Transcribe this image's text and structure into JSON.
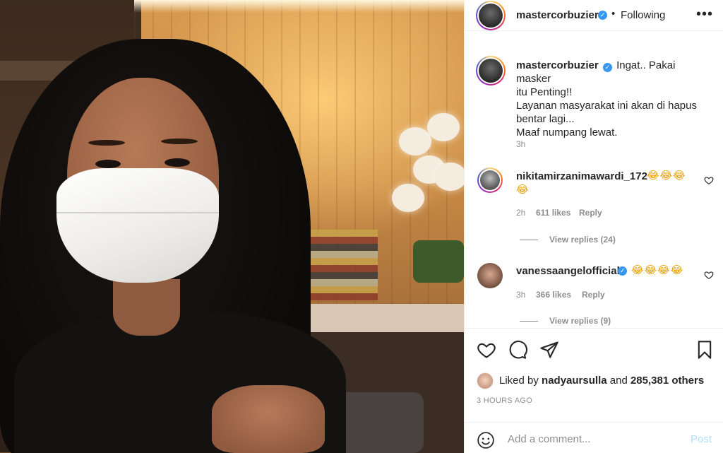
{
  "post": {
    "author": "mastercorbuzier",
    "following_separator": "•",
    "following_label": "Following",
    "more_icon": "more-options-icon",
    "caption_user": "mastercorbuzier",
    "caption_line1": "Ingat.. Pakai masker",
    "caption_line2": "itu Penting!!",
    "caption_line3": "Layanan masyarakat ini akan di hapus",
    "caption_line4": "bentar lagi...",
    "caption_line5": "Maaf numpang lewat.",
    "caption_time": "3h"
  },
  "comments": [
    {
      "user": "nikitamirzanimawardi_172",
      "emoji_line1": "😂😂😂",
      "emoji_line2": "😂",
      "time": "2h",
      "likes": "611 likes",
      "reply": "Reply",
      "view_replies": "View replies (24)"
    },
    {
      "user": "vanessaangelofficial",
      "emoji_line1": "😂😂😂😂",
      "time": "3h",
      "likes": "366 likes",
      "reply": "Reply",
      "view_replies": "View replies (9)"
    }
  ],
  "likes": {
    "prefix": "Liked by",
    "user": "nadyaursulla",
    "connector": "and",
    "others": "285,381 others"
  },
  "posted_time": "3 HOURS AGO",
  "add_comment": {
    "placeholder": "Add a comment...",
    "post_label": "Post"
  },
  "colors": {
    "verified": "#3897f0",
    "muted": "#8e8e8e",
    "post_disabled": "#b2dffc"
  }
}
